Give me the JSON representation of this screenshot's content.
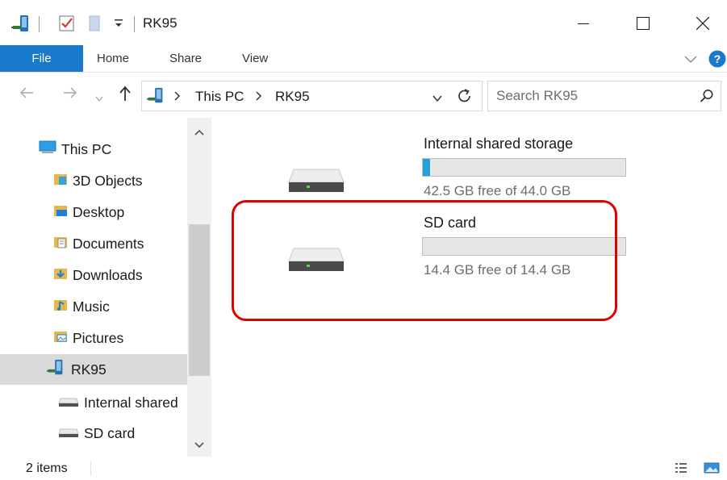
{
  "window": {
    "title": "RK95"
  },
  "ribbon": {
    "tabs": [
      {
        "label": "File",
        "active": true
      },
      {
        "label": "Home"
      },
      {
        "label": "Share"
      },
      {
        "label": "View"
      }
    ]
  },
  "address": {
    "segments": [
      "This PC",
      "RK95"
    ]
  },
  "search": {
    "placeholder": "Search RK95"
  },
  "nav_pane": {
    "items": [
      {
        "label": "This PC",
        "icon": "computer-icon"
      },
      {
        "label": "3D Objects",
        "icon": "3d-objects-icon"
      },
      {
        "label": "Desktop",
        "icon": "desktop-folder-icon"
      },
      {
        "label": "Documents",
        "icon": "documents-folder-icon"
      },
      {
        "label": "Downloads",
        "icon": "downloads-folder-icon"
      },
      {
        "label": "Music",
        "icon": "music-folder-icon"
      },
      {
        "label": "Pictures",
        "icon": "pictures-folder-icon"
      },
      {
        "label": "RK95",
        "icon": "portable-device-icon",
        "selected": true
      },
      {
        "label": "Internal shared",
        "icon": "drive-icon"
      },
      {
        "label": "SD card",
        "icon": "drive-icon"
      }
    ]
  },
  "drives": [
    {
      "name": "Internal shared storage",
      "free_text": "42.5 GB free of 44.0 GB",
      "used_fraction": 0.034
    },
    {
      "name": "SD card",
      "free_text": "14.4 GB free of 14.4 GB",
      "used_fraction": 0.0
    }
  ],
  "status": {
    "item_count": "2 items"
  },
  "colors": {
    "accent": "#1979ca",
    "usage_bar": "#26a0da",
    "highlight": "#e00000",
    "selected_bg": "#d9d9d9"
  }
}
